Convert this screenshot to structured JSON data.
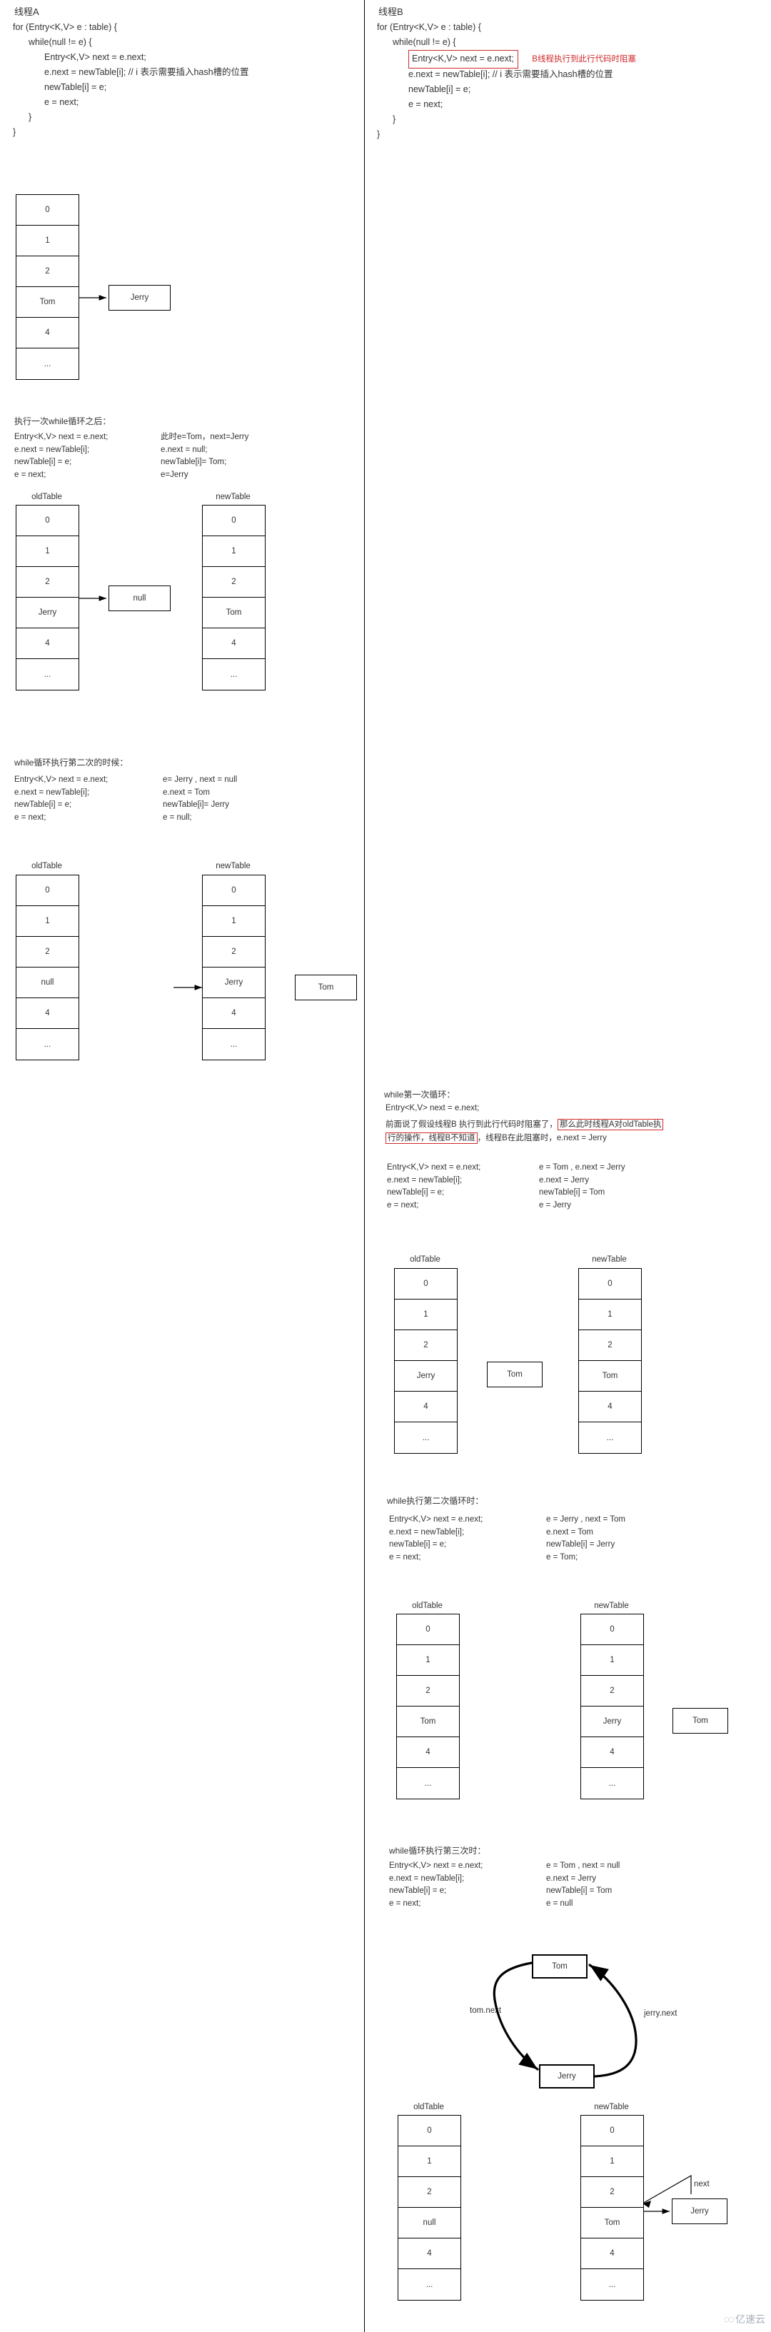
{
  "divider_color": "#000000",
  "highlight_color": "#d02a2a",
  "left": {
    "thread_title": "线程A",
    "code": [
      "for (Entry<K,V> e : table) {",
      "while(null != e) {",
      "Entry<K,V> next = e.next;",
      "e.next = newTable[i];  // i 表示需要插入hash槽的位置",
      "newTable[i] = e;",
      "e = next;",
      "}",
      "}"
    ],
    "table1": {
      "cells": [
        "0",
        "1",
        "2",
        "Tom",
        "4",
        "..."
      ],
      "node_label": "Jerry"
    },
    "step1": {
      "title": "执行一次while循环之后：",
      "code_lines": [
        "Entry<K,V> next = e.next;",
        "e.next = newTable[i];",
        "newTable[i] = e;",
        "e = next;"
      ],
      "value_lines": [
        "此时e=Tom，next=Jerry",
        "e.next = null;",
        "newTable[i]= Tom;",
        "e=Jerry"
      ],
      "old_caption": "oldTable",
      "new_caption": "newTable",
      "old_cells": [
        "0",
        "1",
        "2",
        "Jerry",
        "4",
        "..."
      ],
      "new_cells": [
        "0",
        "1",
        "2",
        "Tom",
        "4",
        "..."
      ],
      "node_label": "null"
    },
    "step2": {
      "title": "while循环执行第二次的时候：",
      "code_lines": [
        "Entry<K,V> next = e.next;",
        "e.next = newTable[i];",
        "newTable[i] = e;",
        "e = next;"
      ],
      "value_lines": [
        "e= Jerry , next = null",
        "e.next = Tom",
        "newTable[i]= Jerry",
        "e = null;"
      ],
      "old_caption": "oldTable",
      "new_caption": "newTable",
      "old_cells": [
        "0",
        "1",
        "2",
        "null",
        "4",
        "..."
      ],
      "new_cells": [
        "0",
        "1",
        "2",
        "Jerry",
        "4",
        "..."
      ],
      "node_label": "Tom"
    }
  },
  "right": {
    "thread_title": "线程B",
    "code": [
      "for (Entry<K,V> e : table) {",
      "while(null != e) {",
      "Entry<K,V> next = e.next;",
      "e.next = newTable[i];  // i 表示需要插入hash槽的位置",
      "newTable[i] = e;",
      "e = next;",
      "}",
      "}"
    ],
    "blocked_note": "B线程执行到此行代码时阻塞",
    "loop1": {
      "title": "while第一次循环：",
      "lead_line": "Entry<K,V> next = e.next;",
      "narr_prefix": "前面说了假设线程B 执行到此行代码时阻塞了，",
      "narr_hl1": "那么此时线程A对oldTable执",
      "narr_hl2": "行的操作，线程B不知道",
      "narr_suffix": "，线程B在此阻塞时，e.next = Jerry",
      "code_lines": [
        "Entry<K,V> next = e.next;",
        "e.next = newTable[i];",
        "newTable[i] = e;",
        "e = next;"
      ],
      "value_lines": [
        "e = Tom , e.next = Jerry",
        "e.next = Jerry",
        "newTable[i] = Tom",
        "e = Jerry"
      ],
      "old_caption": "oldTable",
      "new_caption": "newTable",
      "old_cells": [
        "0",
        "1",
        "2",
        "Jerry",
        "4",
        "..."
      ],
      "new_cells": [
        "0",
        "1",
        "2",
        "Tom",
        "4",
        "..."
      ],
      "node_label": "Tom"
    },
    "loop2": {
      "title": "while执行第二次循环时：",
      "code_lines": [
        "Entry<K,V> next = e.next;",
        "e.next = newTable[i];",
        "newTable[i] = e;",
        "e = next;"
      ],
      "value_lines": [
        "e = Jerry , next = Tom",
        "e.next = Tom",
        "newTable[i] = Jerry",
        "e = Tom;"
      ],
      "old_caption": "oldTable",
      "new_caption": "newTable",
      "old_cells": [
        "0",
        "1",
        "2",
        "Tom",
        "4",
        "..."
      ],
      "new_cells": [
        "0",
        "1",
        "2",
        "Jerry",
        "4",
        "..."
      ],
      "node_label": "Tom"
    },
    "loop3": {
      "title": "while循环执行第三次时：",
      "code_lines": [
        "Entry<K,V> next = e.next;",
        "e.next = newTable[i];",
        "newTable[i] = e;",
        "e = next;"
      ],
      "value_lines": [
        "e = Tom , next = null",
        "e.next = Jerry",
        "newTable[i] = Tom",
        "e = null"
      ],
      "cycle": {
        "top_label": "Tom",
        "bottom_label": "Jerry",
        "left_edge_label": "tom.next",
        "right_edge_label": "jerry.next"
      },
      "old_caption": "oldTable",
      "new_caption": "newTable",
      "old_cells": [
        "0",
        "1",
        "2",
        "null",
        "4",
        "..."
      ],
      "new_cells": [
        "0",
        "1",
        "2",
        "Tom",
        "4",
        "..."
      ],
      "node_label": "Jerry",
      "next_label": "next"
    }
  },
  "watermark": {
    "glyph": "◌◌",
    "text": "亿速云"
  }
}
